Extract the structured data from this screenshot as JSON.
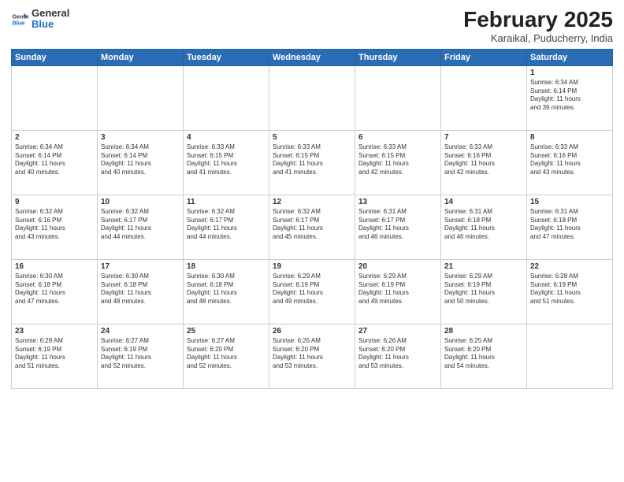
{
  "header": {
    "logo_line1": "General",
    "logo_line2": "Blue",
    "month": "February 2025",
    "location": "Karaikal, Puducherry, India"
  },
  "weekdays": [
    "Sunday",
    "Monday",
    "Tuesday",
    "Wednesday",
    "Thursday",
    "Friday",
    "Saturday"
  ],
  "weeks": [
    [
      {
        "day": "",
        "info": ""
      },
      {
        "day": "",
        "info": ""
      },
      {
        "day": "",
        "info": ""
      },
      {
        "day": "",
        "info": ""
      },
      {
        "day": "",
        "info": ""
      },
      {
        "day": "",
        "info": ""
      },
      {
        "day": "1",
        "info": "Sunrise: 6:34 AM\nSunset: 6:14 PM\nDaylight: 11 hours\nand 39 minutes."
      }
    ],
    [
      {
        "day": "2",
        "info": "Sunrise: 6:34 AM\nSunset: 6:14 PM\nDaylight: 11 hours\nand 40 minutes."
      },
      {
        "day": "3",
        "info": "Sunrise: 6:34 AM\nSunset: 6:14 PM\nDaylight: 11 hours\nand 40 minutes."
      },
      {
        "day": "4",
        "info": "Sunrise: 6:33 AM\nSunset: 6:15 PM\nDaylight: 11 hours\nand 41 minutes."
      },
      {
        "day": "5",
        "info": "Sunrise: 6:33 AM\nSunset: 6:15 PM\nDaylight: 11 hours\nand 41 minutes."
      },
      {
        "day": "6",
        "info": "Sunrise: 6:33 AM\nSunset: 6:15 PM\nDaylight: 11 hours\nand 42 minutes."
      },
      {
        "day": "7",
        "info": "Sunrise: 6:33 AM\nSunset: 6:16 PM\nDaylight: 11 hours\nand 42 minutes."
      },
      {
        "day": "8",
        "info": "Sunrise: 6:33 AM\nSunset: 6:16 PM\nDaylight: 11 hours\nand 43 minutes."
      }
    ],
    [
      {
        "day": "9",
        "info": "Sunrise: 6:32 AM\nSunset: 6:16 PM\nDaylight: 11 hours\nand 43 minutes."
      },
      {
        "day": "10",
        "info": "Sunrise: 6:32 AM\nSunset: 6:17 PM\nDaylight: 11 hours\nand 44 minutes."
      },
      {
        "day": "11",
        "info": "Sunrise: 6:32 AM\nSunset: 6:17 PM\nDaylight: 11 hours\nand 44 minutes."
      },
      {
        "day": "12",
        "info": "Sunrise: 6:32 AM\nSunset: 6:17 PM\nDaylight: 11 hours\nand 45 minutes."
      },
      {
        "day": "13",
        "info": "Sunrise: 6:31 AM\nSunset: 6:17 PM\nDaylight: 11 hours\nand 46 minutes."
      },
      {
        "day": "14",
        "info": "Sunrise: 6:31 AM\nSunset: 6:18 PM\nDaylight: 11 hours\nand 46 minutes."
      },
      {
        "day": "15",
        "info": "Sunrise: 6:31 AM\nSunset: 6:18 PM\nDaylight: 11 hours\nand 47 minutes."
      }
    ],
    [
      {
        "day": "16",
        "info": "Sunrise: 6:30 AM\nSunset: 6:18 PM\nDaylight: 11 hours\nand 47 minutes."
      },
      {
        "day": "17",
        "info": "Sunrise: 6:30 AM\nSunset: 6:18 PM\nDaylight: 11 hours\nand 48 minutes."
      },
      {
        "day": "18",
        "info": "Sunrise: 6:30 AM\nSunset: 6:18 PM\nDaylight: 11 hours\nand 48 minutes."
      },
      {
        "day": "19",
        "info": "Sunrise: 6:29 AM\nSunset: 6:19 PM\nDaylight: 11 hours\nand 49 minutes."
      },
      {
        "day": "20",
        "info": "Sunrise: 6:29 AM\nSunset: 6:19 PM\nDaylight: 11 hours\nand 49 minutes."
      },
      {
        "day": "21",
        "info": "Sunrise: 6:29 AM\nSunset: 6:19 PM\nDaylight: 11 hours\nand 50 minutes."
      },
      {
        "day": "22",
        "info": "Sunrise: 6:28 AM\nSunset: 6:19 PM\nDaylight: 11 hours\nand 51 minutes."
      }
    ],
    [
      {
        "day": "23",
        "info": "Sunrise: 6:28 AM\nSunset: 6:19 PM\nDaylight: 11 hours\nand 51 minutes."
      },
      {
        "day": "24",
        "info": "Sunrise: 6:27 AM\nSunset: 6:19 PM\nDaylight: 11 hours\nand 52 minutes."
      },
      {
        "day": "25",
        "info": "Sunrise: 6:27 AM\nSunset: 6:20 PM\nDaylight: 11 hours\nand 52 minutes."
      },
      {
        "day": "26",
        "info": "Sunrise: 6:26 AM\nSunset: 6:20 PM\nDaylight: 11 hours\nand 53 minutes."
      },
      {
        "day": "27",
        "info": "Sunrise: 6:26 AM\nSunset: 6:20 PM\nDaylight: 11 hours\nand 53 minutes."
      },
      {
        "day": "28",
        "info": "Sunrise: 6:25 AM\nSunset: 6:20 PM\nDaylight: 11 hours\nand 54 minutes."
      },
      {
        "day": "",
        "info": ""
      }
    ]
  ]
}
